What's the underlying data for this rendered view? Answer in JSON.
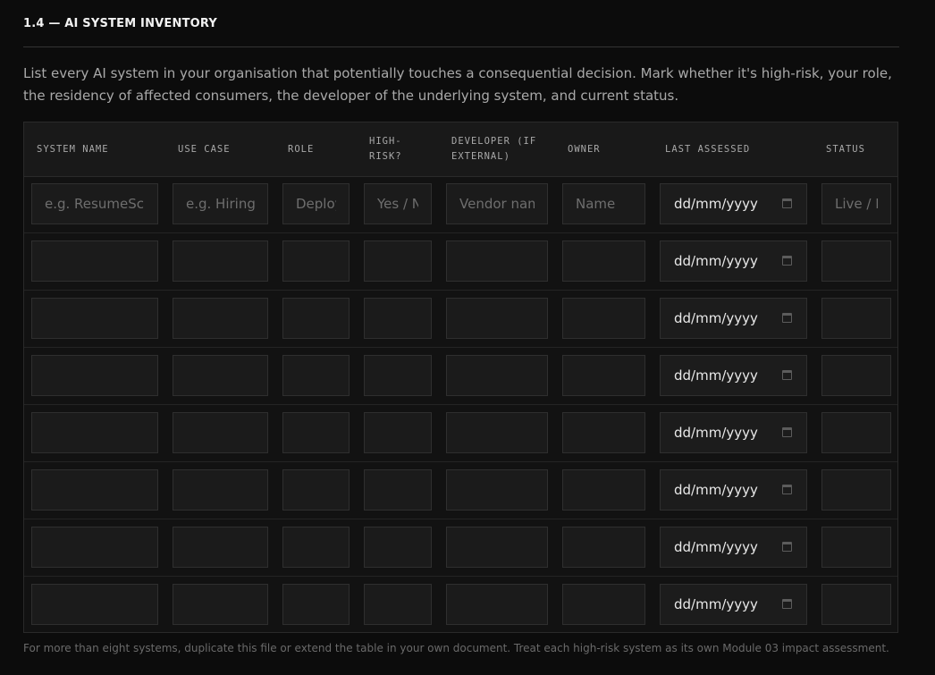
{
  "section": {
    "title": "1.4 — AI SYSTEM INVENTORY",
    "intro": "List every AI system in your organisation that potentially touches a consequential decision. Mark whether it's high-risk, your role, the residency of affected consumers, the developer of the underlying system, and current status."
  },
  "table": {
    "headers": [
      "SYSTEM NAME",
      "USE CASE",
      "ROLE",
      "HIGH-\nRISK?",
      "DEVELOPER (IF\nEXTERNAL)",
      "OWNER",
      "LAST ASSESSED",
      "STATUS"
    ],
    "placeholders": [
      "e.g. ResumeScre",
      "e.g. Hiring s",
      "Deploy",
      "Yes / N",
      "Vendor name",
      "Name",
      "dd/mm/yyyy",
      "Live / P"
    ],
    "date_value": "dd/mm/yyyy",
    "row_count": 8
  },
  "footnote": "For more than eight systems, duplicate this file or extend the table in your own document. Treat each high-risk system as its own Module 03 impact assessment."
}
